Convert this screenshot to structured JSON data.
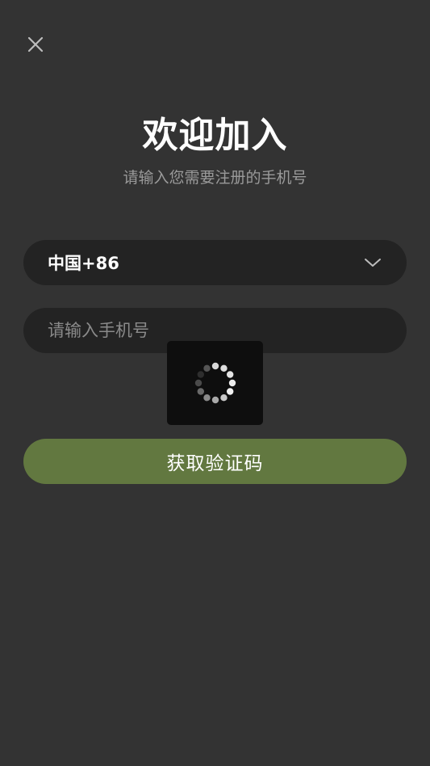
{
  "header": {
    "close_icon": "close-icon"
  },
  "welcome": {
    "title": "欢迎加入",
    "subtitle": "请输入您需要注册的手机号"
  },
  "form": {
    "country_code_label": "中国+86",
    "country_chevron_icon": "chevron-down-icon",
    "phone_value": "",
    "phone_placeholder": "请输入手机号",
    "submit_label": "获取验证码"
  },
  "loading": {
    "icon": "spinner-icon"
  },
  "colors": {
    "background": "#333333",
    "field_background": "#232323",
    "button_accent": "#627840",
    "overlay_background": "#0e0e0e",
    "subtitle_text": "#9a9a9a"
  }
}
